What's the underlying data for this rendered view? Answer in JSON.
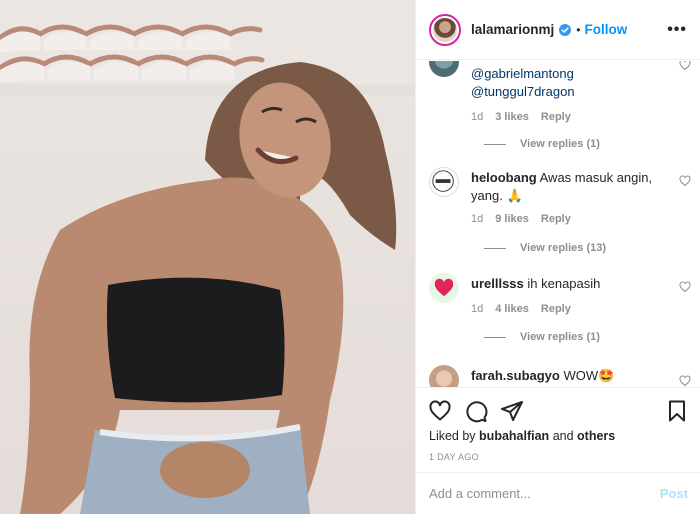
{
  "header": {
    "username": "lalamarionmj",
    "separator": "•",
    "follow_label": "Follow",
    "more_label": "•••"
  },
  "comments": [
    {
      "partial": true,
      "mentions": [
        "@gabrielmantong",
        "@tunggul7dragon"
      ],
      "time": "1d",
      "likes": "3 likes",
      "reply": "Reply",
      "view_replies": "View replies (1)"
    },
    {
      "username": "heloobang",
      "text": "Awas masuk angin, yang.",
      "emoji": "🙏",
      "time": "1d",
      "likes": "9 likes",
      "reply": "Reply",
      "view_replies": "View replies (13)"
    },
    {
      "username": "urelllsss",
      "text": "ih kenapasih",
      "time": "1d",
      "likes": "4 likes",
      "reply": "Reply",
      "view_replies": "View replies (1)"
    },
    {
      "username": "farah.subagyo",
      "text": "WOW",
      "emoji": "🤩"
    }
  ],
  "actions": {
    "icons": [
      "heart-icon",
      "comment-icon",
      "share-icon",
      "bookmark-icon"
    ]
  },
  "likes_line": {
    "prefix": "Liked by",
    "user": "bubahalfian",
    "and": "and",
    "others": "others"
  },
  "date": "1 DAY AGO",
  "add_comment": {
    "placeholder": "Add a comment...",
    "post_label": "Post"
  },
  "colors": {
    "accent": "#0095f6",
    "post_disabled": "#b2dffc",
    "muted": "#8e8e8e",
    "text": "#262626"
  }
}
